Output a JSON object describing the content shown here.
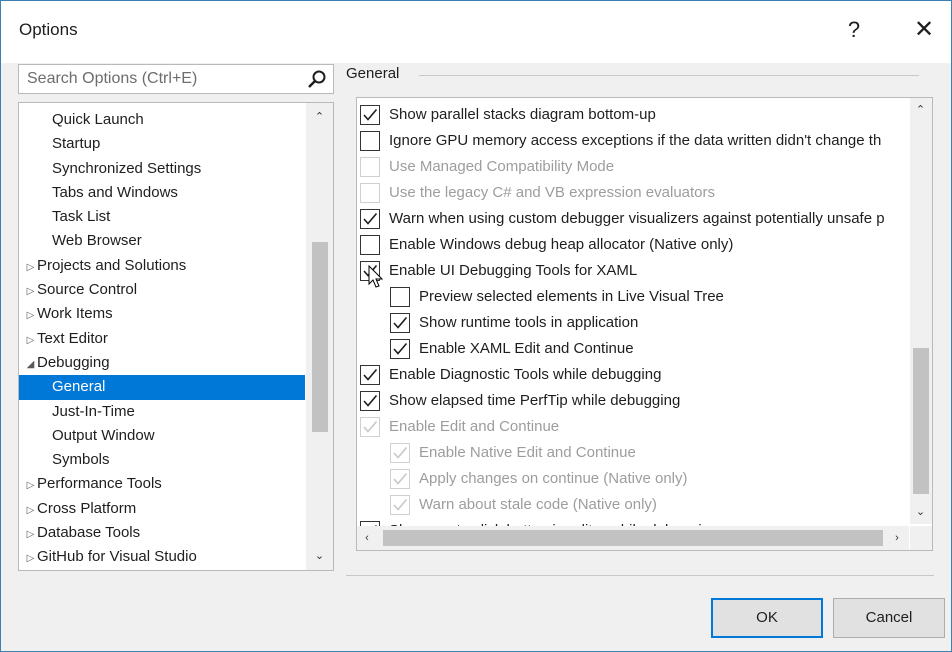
{
  "window": {
    "title": "Options",
    "help_label": "?",
    "close_label": "✕"
  },
  "search": {
    "placeholder": "Search Options (Ctrl+E)",
    "value": ""
  },
  "tree": {
    "items": [
      {
        "label": "Quick Launch",
        "indent": 1,
        "arrow": ""
      },
      {
        "label": "Startup",
        "indent": 1,
        "arrow": ""
      },
      {
        "label": "Synchronized Settings",
        "indent": 1,
        "arrow": ""
      },
      {
        "label": "Tabs and Windows",
        "indent": 1,
        "arrow": ""
      },
      {
        "label": "Task List",
        "indent": 1,
        "arrow": ""
      },
      {
        "label": "Web Browser",
        "indent": 1,
        "arrow": ""
      },
      {
        "label": "Projects and Solutions",
        "indent": 0,
        "arrow": "▷"
      },
      {
        "label": "Source Control",
        "indent": 0,
        "arrow": "▷"
      },
      {
        "label": "Work Items",
        "indent": 0,
        "arrow": "▷"
      },
      {
        "label": "Text Editor",
        "indent": 0,
        "arrow": "▷"
      },
      {
        "label": "Debugging",
        "indent": 0,
        "arrow": "◢"
      },
      {
        "label": "General",
        "indent": 1,
        "arrow": "",
        "selected": true
      },
      {
        "label": "Just-In-Time",
        "indent": 1,
        "arrow": ""
      },
      {
        "label": "Output Window",
        "indent": 1,
        "arrow": ""
      },
      {
        "label": "Symbols",
        "indent": 1,
        "arrow": ""
      },
      {
        "label": "Performance Tools",
        "indent": 0,
        "arrow": "▷"
      },
      {
        "label": "Cross Platform",
        "indent": 0,
        "arrow": "▷"
      },
      {
        "label": "Database Tools",
        "indent": 0,
        "arrow": "▷"
      },
      {
        "label": "GitHub for Visual Studio",
        "indent": 0,
        "arrow": "▷"
      }
    ]
  },
  "section": {
    "title": "General"
  },
  "options": [
    {
      "label": "Show parallel stacks diagram bottom-up",
      "checked": true,
      "disabled": false,
      "level": 0
    },
    {
      "label": "Ignore GPU memory access exceptions if the data written didn't change th",
      "checked": false,
      "disabled": false,
      "level": 0
    },
    {
      "label": "Use Managed Compatibility Mode",
      "checked": false,
      "disabled": true,
      "level": 0
    },
    {
      "label": "Use the legacy C# and VB expression evaluators",
      "checked": false,
      "disabled": true,
      "level": 0
    },
    {
      "label": "Warn when using custom debugger visualizers against potentially unsafe p",
      "checked": true,
      "disabled": false,
      "level": 0
    },
    {
      "label": "Enable Windows debug heap allocator (Native only)",
      "checked": false,
      "disabled": false,
      "level": 0
    },
    {
      "label": "Enable UI Debugging Tools for XAML",
      "checked": true,
      "disabled": false,
      "level": 0
    },
    {
      "label": "Preview selected elements in Live Visual Tree",
      "checked": false,
      "disabled": false,
      "level": 1
    },
    {
      "label": "Show runtime tools in application",
      "checked": true,
      "disabled": false,
      "level": 1
    },
    {
      "label": "Enable XAML Edit and Continue",
      "checked": true,
      "disabled": false,
      "level": 1
    },
    {
      "label": "Enable Diagnostic Tools while debugging",
      "checked": true,
      "disabled": false,
      "level": 0
    },
    {
      "label": "Show elapsed time PerfTip while debugging",
      "checked": true,
      "disabled": false,
      "level": 0
    },
    {
      "label": "Enable Edit and Continue",
      "checked": true,
      "disabled": true,
      "level": 0
    },
    {
      "label": "Enable Native Edit and Continue",
      "checked": true,
      "disabled": true,
      "level": 1
    },
    {
      "label": "Apply changes on continue (Native only)",
      "checked": true,
      "disabled": true,
      "level": 1
    },
    {
      "label": "Warn about stale code (Native only)",
      "checked": true,
      "disabled": true,
      "level": 1
    },
    {
      "label": "Show run to click button in editor while debugging",
      "checked": true,
      "disabled": false,
      "level": 0
    }
  ],
  "buttons": {
    "ok": "OK",
    "cancel": "Cancel"
  }
}
